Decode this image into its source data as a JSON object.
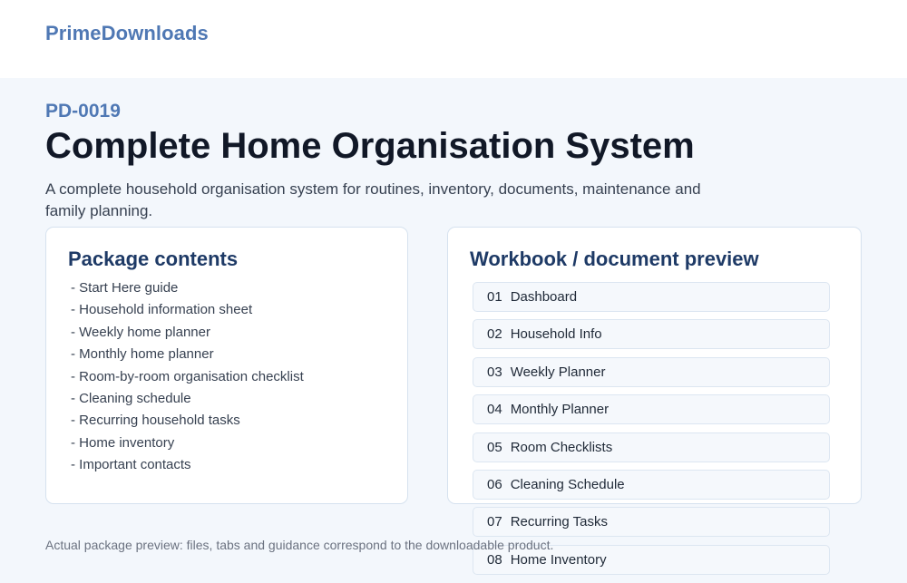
{
  "header": {
    "brand": "PrimeDownloads"
  },
  "product": {
    "sku": "PD-0019",
    "title": "Complete Home Organisation System",
    "description": "A complete household organisation system for routines, inventory, documents, maintenance and family planning."
  },
  "contents_panel": {
    "heading": "Package contents",
    "items": [
      "- Start Here guide",
      "- Household information sheet",
      "- Weekly home planner",
      "- Monthly home planner",
      "- Room-by-room organisation checklist",
      "- Cleaning schedule",
      "- Recurring household tasks",
      "- Home inventory",
      "- Important contacts"
    ]
  },
  "preview_panel": {
    "heading": "Workbook / document preview",
    "sheets": [
      {
        "num": "01",
        "name": "Dashboard"
      },
      {
        "num": "02",
        "name": "Household Info"
      },
      {
        "num": "03",
        "name": "Weekly Planner"
      },
      {
        "num": "04",
        "name": "Monthly Planner"
      },
      {
        "num": "05",
        "name": "Room Checklists"
      },
      {
        "num": "06",
        "name": "Cleaning Schedule"
      },
      {
        "num": "07",
        "name": "Recurring Tasks"
      },
      {
        "num": "08",
        "name": "Home Inventory"
      }
    ]
  },
  "footer": {
    "note": "Actual package preview: files, tabs and guidance correspond to the downloadable product."
  },
  "colors": {
    "brand": "#4f78b4",
    "panel_heading": "#1e3a66",
    "page_background": "#f3f7fc"
  }
}
